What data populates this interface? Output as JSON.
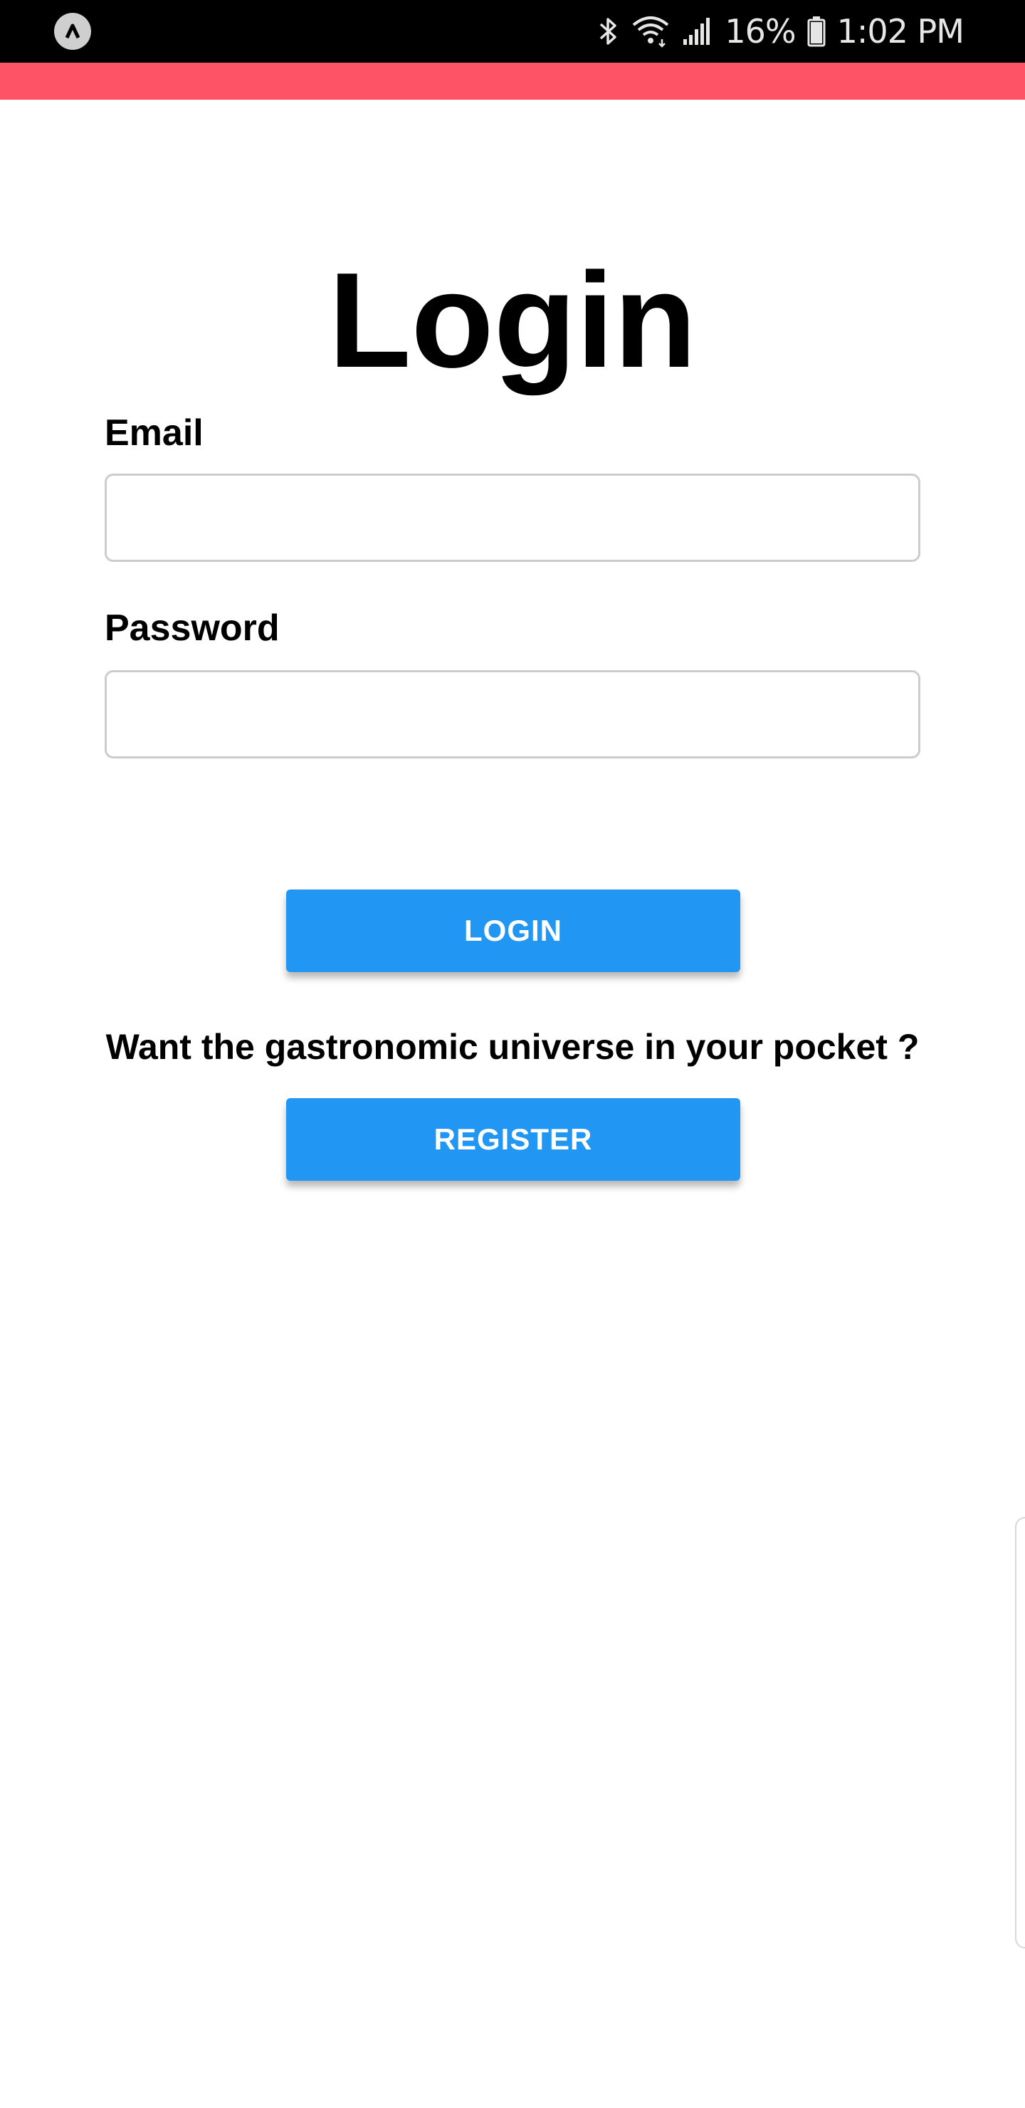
{
  "status_bar": {
    "battery_percent": "16%",
    "time": "1:02 PM",
    "icons": [
      "app-notification-icon",
      "bluetooth-icon",
      "wifi-icon",
      "signal-icon",
      "battery-icon"
    ]
  },
  "colors": {
    "accent_bar": "#fe5366",
    "button": "#2196f3",
    "button_text": "#ffffff"
  },
  "login_form": {
    "title": "Login",
    "email_label": "Email",
    "email_value": "",
    "password_label": "Password",
    "password_value": "",
    "login_button": "LOGIN"
  },
  "register": {
    "prompt": "Want the gastronomic universe in your pocket ?",
    "register_button": "REGISTER"
  }
}
